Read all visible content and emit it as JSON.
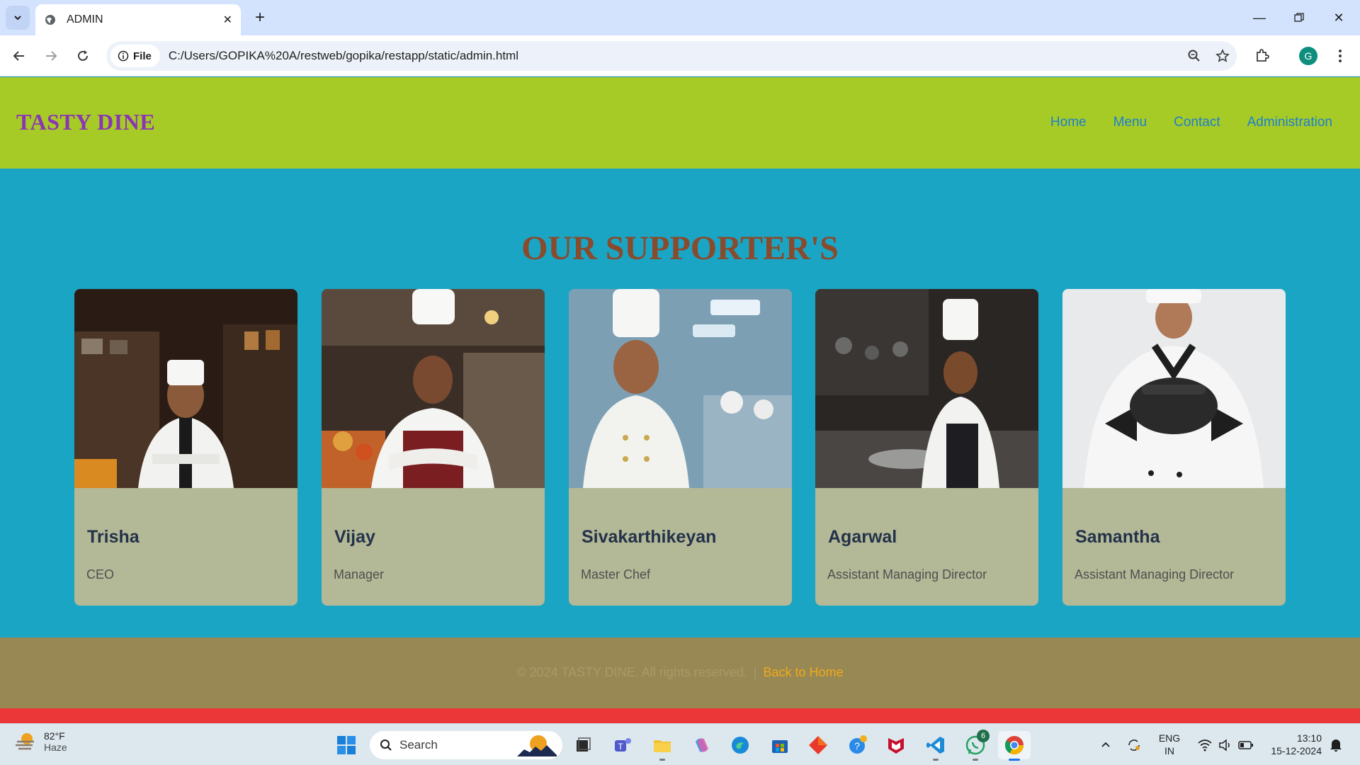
{
  "browser": {
    "tab_title": "ADMIN",
    "site_chip_label": "File",
    "url": "C:/Users/GOPIKA%20A/restweb/gopika/restapp/static/admin.html",
    "profile_initial": "G"
  },
  "site": {
    "logo": "TASTY DINE",
    "nav": [
      "Home",
      "Menu",
      "Contact",
      "Administration"
    ],
    "section_title": "OUR SUPPORTER'S",
    "cards": [
      {
        "name": "Trisha",
        "role": "CEO"
      },
      {
        "name": "Vijay",
        "role": "Manager"
      },
      {
        "name": "Sivakarthikeyan",
        "role": "Master Chef"
      },
      {
        "name": "Agarwal",
        "role": "Assistant Managing Director"
      },
      {
        "name": "Samantha",
        "role": "Assistant Managing Director"
      }
    ],
    "footer": {
      "copyright": "© 2024 TASTY DINE. All rights reserved.",
      "separator": "|",
      "back_link": "Back to Home"
    }
  },
  "taskbar": {
    "weather_temp": "82°F",
    "weather_condition": "Haze",
    "search_label": "Search",
    "whatsapp_badge": "6",
    "language": "ENG",
    "region": "IN",
    "time": "13:10",
    "date": "15-12-2024"
  },
  "colors": {
    "header_bg": "#a7cb26",
    "main_bg": "#1aa5c4",
    "card_bg": "#b3b896",
    "footer_bg": "#988954",
    "logo": "#8a36b4",
    "title": "#8a4a2c",
    "link": "#1b7fd1",
    "back_link": "#f0a81a"
  }
}
